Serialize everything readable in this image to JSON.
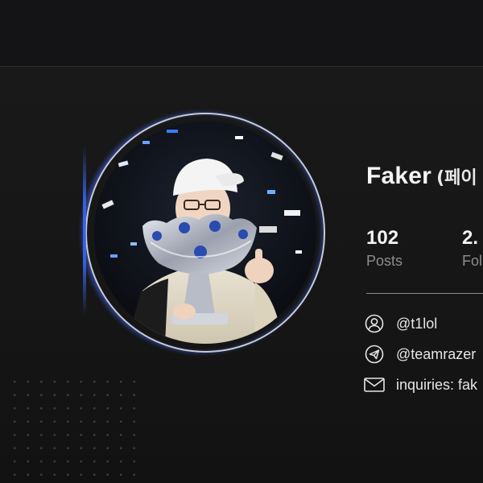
{
  "profile": {
    "name": "Faker",
    "name_native": "(페이"
  },
  "stats": [
    {
      "value": "102",
      "label": "Posts"
    },
    {
      "value": "2.",
      "label": "Fol"
    }
  ],
  "contacts": [
    {
      "icon": "user-icon",
      "text": "@t1lol"
    },
    {
      "icon": "send-icon",
      "text": "@teamrazer"
    },
    {
      "icon": "mail-icon",
      "text": "inquiries: fak"
    }
  ],
  "colors": {
    "background": "#141414",
    "ring_accent": "#3e6bff",
    "muted_text": "#8d8d8d"
  }
}
